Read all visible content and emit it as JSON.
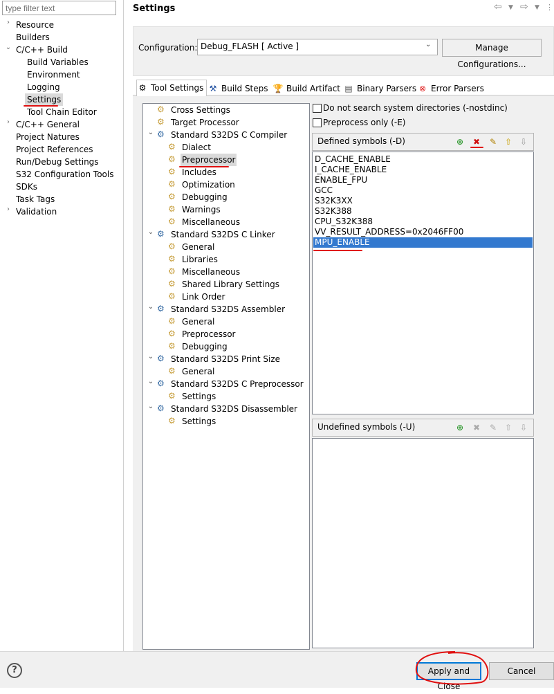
{
  "filter": {
    "placeholder": "type filter text"
  },
  "nav": {
    "items": [
      {
        "label": "Resource"
      },
      {
        "label": "Builders"
      },
      {
        "label": "C/C++ Build"
      },
      {
        "label": "Build Variables"
      },
      {
        "label": "Environment"
      },
      {
        "label": "Logging"
      },
      {
        "label": "Settings"
      },
      {
        "label": "Tool Chain Editor"
      },
      {
        "label": "C/C++ General"
      },
      {
        "label": "Project Natures"
      },
      {
        "label": "Project References"
      },
      {
        "label": "Run/Debug Settings"
      },
      {
        "label": "S32 Configuration Tools"
      },
      {
        "label": "SDKs"
      },
      {
        "label": "Task Tags"
      },
      {
        "label": "Validation"
      }
    ]
  },
  "header": {
    "title": "Settings"
  },
  "config": {
    "label": "Configuration:",
    "value": "Debug_FLASH  [ Active ]",
    "manage": "Manage Configurations..."
  },
  "tabs": [
    {
      "label": "Tool Settings"
    },
    {
      "label": "Build Steps"
    },
    {
      "label": "Build Artifact"
    },
    {
      "label": "Binary Parsers"
    },
    {
      "label": "Error Parsers"
    }
  ],
  "tree": [
    {
      "label": "Cross Settings"
    },
    {
      "label": "Target Processor"
    },
    {
      "label": "Standard S32DS C Compiler"
    },
    {
      "label": "Dialect"
    },
    {
      "label": "Preprocessor"
    },
    {
      "label": "Includes"
    },
    {
      "label": "Optimization"
    },
    {
      "label": "Debugging"
    },
    {
      "label": "Warnings"
    },
    {
      "label": "Miscellaneous"
    },
    {
      "label": "Standard S32DS C Linker"
    },
    {
      "label": "General"
    },
    {
      "label": "Libraries"
    },
    {
      "label": "Miscellaneous"
    },
    {
      "label": "Shared Library Settings"
    },
    {
      "label": "Link Order"
    },
    {
      "label": "Standard S32DS Assembler"
    },
    {
      "label": "General"
    },
    {
      "label": "Preprocessor"
    },
    {
      "label": "Debugging"
    },
    {
      "label": "Standard S32DS Print Size"
    },
    {
      "label": "General"
    },
    {
      "label": "Standard S32DS C Preprocessor"
    },
    {
      "label": "Settings"
    },
    {
      "label": "Standard S32DS Disassembler"
    },
    {
      "label": "Settings"
    }
  ],
  "options": {
    "nostdinc": "Do not search system directories (-nostdinc)",
    "preprocess_only": "Preprocess only (-E)"
  },
  "defined": {
    "title": "Defined symbols (-D)",
    "symbols": [
      "D_CACHE_ENABLE",
      "I_CACHE_ENABLE",
      "ENABLE_FPU",
      "GCC",
      "S32K3XX",
      "S32K388",
      "CPU_S32K388",
      "VV_RESULT_ADDRESS=0x2046FF00",
      "MPU_ENABLE"
    ]
  },
  "undefined": {
    "title": "Undefined symbols (-U)"
  },
  "buttons": {
    "help": "?",
    "apply": "Apply and Close",
    "cancel": "Cancel"
  }
}
